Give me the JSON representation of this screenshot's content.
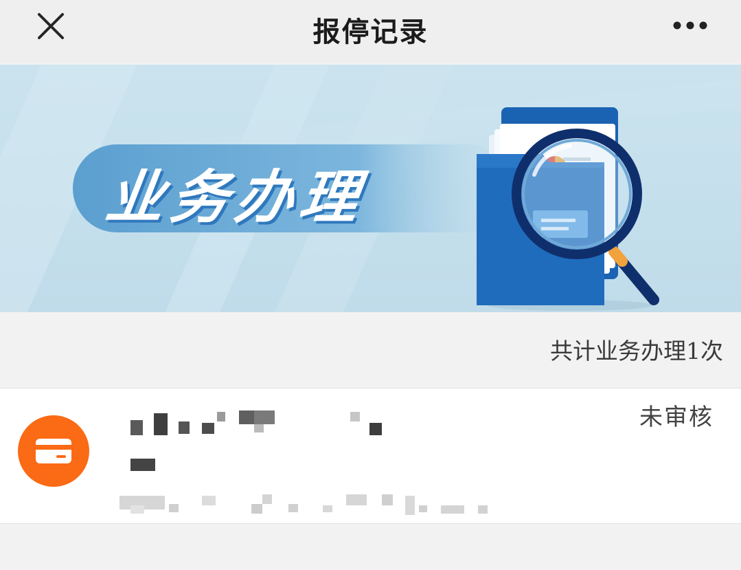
{
  "nav": {
    "title": "报停记录",
    "close_icon": "close-icon",
    "more_icon": "more-dots-icon"
  },
  "banner": {
    "text": "业务办理",
    "illustration": "folder-magnifier-illustration"
  },
  "summary": {
    "text": "共计业务办理1次"
  },
  "record": {
    "icon": "card-icon",
    "status": "未审核",
    "accent_color": "#fb6a15"
  },
  "colors": {
    "banner_bg": "#c7e0ec",
    "banner_pill": "#5fa3d3",
    "folder_blue": "#1c6fc2"
  }
}
